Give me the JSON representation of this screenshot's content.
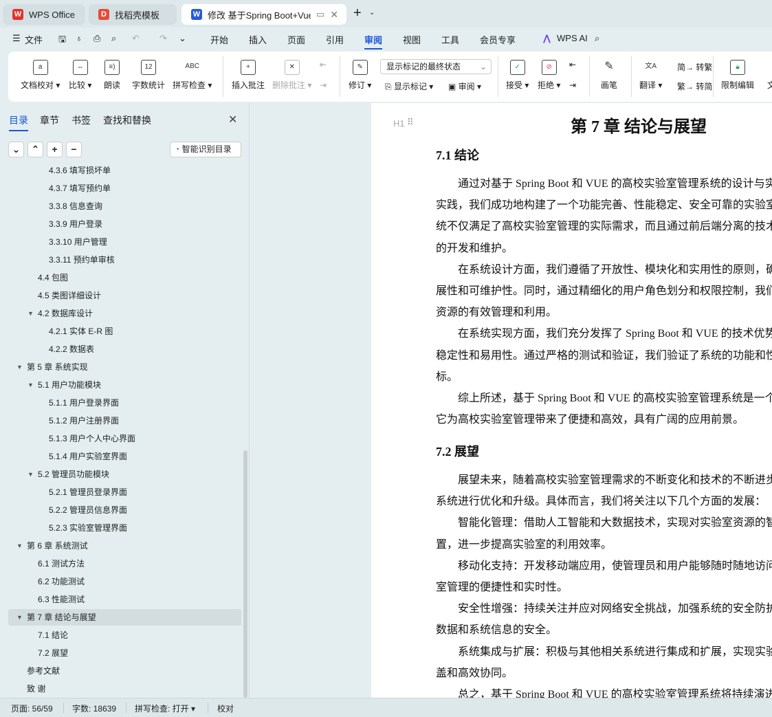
{
  "tabs": [
    {
      "label": "WPS Office",
      "icon": "wps-logo",
      "color": "#e3322b"
    },
    {
      "label": "找稻壳模板",
      "icon": "docer-logo",
      "color": "#e84b3c"
    },
    {
      "label": "修改 基于Spring Boot+Vue的",
      "icon": "word-doc-logo",
      "color": "#2a5ad9",
      "active": true
    }
  ],
  "menu": {
    "file": "文件",
    "items": [
      "开始",
      "插入",
      "页面",
      "引用",
      "审阅",
      "视图",
      "工具",
      "会员专享"
    ],
    "active": "审阅",
    "ai": "WPS AI"
  },
  "ribbon": {
    "proofread": "文档校对",
    "compare": "比较",
    "read_aloud": "朗读",
    "word_count": "字数统计",
    "spell_check": "拼写检查",
    "insert_comment": "插入批注",
    "delete_comment": "删除批注",
    "track_changes": "修订",
    "markup_select": "显示标记的最终状态",
    "show_markup": "显示标记",
    "review": "审阅",
    "accept": "接受",
    "reject": "拒绝",
    "pen": "画笔",
    "translate": "翻译",
    "to_traditional": "转繁",
    "to_simplified": "转简",
    "restrict_edit": "限制编辑",
    "doc_cut": "文"
  },
  "sidebar": {
    "tabs": [
      "目录",
      "章节",
      "书签",
      "查找和替换"
    ],
    "smart_toc": "智能识别目录",
    "items": [
      {
        "label": "4.3.6 填写损坏单",
        "level": 3
      },
      {
        "label": "4.3.7 填写预约单",
        "level": 3
      },
      {
        "label": "3.3.8 信息查询",
        "level": 3
      },
      {
        "label": "3.3.9 用户登录",
        "level": 3
      },
      {
        "label": "3.3.10 用户管理",
        "level": 3
      },
      {
        "label": "3.3.11 预约单审核",
        "level": 3
      },
      {
        "label": "4.4  包图",
        "level": 2
      },
      {
        "label": "4.5 类图详细设计",
        "level": 2
      },
      {
        "label": "4.2  数据库设计",
        "level": 2,
        "expanded": true
      },
      {
        "label": "4.2.1  实体 E-R 图",
        "level": 3
      },
      {
        "label": "4.2.2  数据表",
        "level": 3
      },
      {
        "label": "第 5 章  系统实现",
        "level": 1,
        "expanded": true
      },
      {
        "label": "5.1  用户功能模块",
        "level": 2,
        "expanded": true
      },
      {
        "label": "5.1.1  用户登录界面",
        "level": 3
      },
      {
        "label": "5.1.2  用户注册界面",
        "level": 3
      },
      {
        "label": "5.1.3  用户个人中心界面",
        "level": 3
      },
      {
        "label": "5.1.4  用户实验室界面",
        "level": 3
      },
      {
        "label": "5.2  管理员功能模块",
        "level": 2,
        "expanded": true
      },
      {
        "label": "5.2.1  管理员登录界面",
        "level": 3
      },
      {
        "label": "5.2.2  管理员信息界面",
        "level": 3
      },
      {
        "label": "5.2.3  实验室管理界面",
        "level": 3
      },
      {
        "label": "第 6 章  系统测试",
        "level": 1,
        "expanded": true
      },
      {
        "label": "6.1  测试方法",
        "level": 2
      },
      {
        "label": "6.2  功能测试",
        "level": 2
      },
      {
        "label": "6.3  性能测试",
        "level": 2
      },
      {
        "label": "第 7 章   结论与展望",
        "level": 1,
        "expanded": true,
        "selected": true
      },
      {
        "label": "7.1  结论",
        "level": 2
      },
      {
        "label": "7.2  展望",
        "level": 2
      },
      {
        "label": "参考文献",
        "level": 1
      },
      {
        "label": "致   谢",
        "level": 1
      }
    ]
  },
  "document": {
    "heading_marker": "H1",
    "chapter_title": "第 7 章   结论与展望",
    "sec1": "7.1  结论",
    "sec2": "7.2  展望",
    "lines1": [
      {
        "t": "通过对基于 Spring Boot 和 VUE 的高校实验室管理系统的设计与实",
        "i": true
      },
      {
        "t": "实践，我们成功地构建了一个功能完善、性能稳定、安全可靠的实验室"
      },
      {
        "t": "统不仅满足了高校实验室管理的实际需求，而且通过前后端分离的技术"
      },
      {
        "t": "的开发和维护。"
      },
      {
        "t": "在系统设计方面，我们遵循了开放性、模块化和实用性的原则，确",
        "i": true
      },
      {
        "t": "展性和可维护性。同时，通过精细化的用户角色划分和权限控制，我们"
      },
      {
        "t": "资源的有效管理和利用。"
      },
      {
        "t": "在系统实现方面，我们充分发挥了 Spring Boot 和 VUE 的技术优势",
        "i": true
      },
      {
        "t": "稳定性和易用性。通过严格的测试和验证，我们验证了系统的功能和性"
      },
      {
        "t": "标。"
      },
      {
        "t": "综上所述，基于 Spring Boot 和 VUE 的高校实验室管理系统是一个成",
        "i": true
      },
      {
        "t": "它为高校实验室管理带来了便捷和高效，具有广阔的应用前景。"
      }
    ],
    "lines2": [
      {
        "t": "展望未来，随着高校实验室管理需求的不断变化和技术的不断进步",
        "i": true
      },
      {
        "t": "系统进行优化和升级。具体而言，我们将关注以下几个方面的发展："
      },
      {
        "t": "智能化管理：借助人工智能和大数据技术，实现对实验室资源的智",
        "i": true
      },
      {
        "t": "置，进一步提高实验室的利用效率。"
      },
      {
        "t": "移动化支持：开发移动端应用，使管理员和用户能够随时随地访问",
        "i": true
      },
      {
        "t": "室管理的便捷性和实时性。"
      },
      {
        "t": "安全性增强：持续关注并应对网络安全挑战，加强系统的安全防护",
        "i": true
      },
      {
        "t": "数据和系统信息的安全。"
      },
      {
        "t": "系统集成与扩展：积极与其他相关系统进行集成和扩展，实现实验",
        "i": true
      },
      {
        "t": "盖和高效协同。"
      },
      {
        "t": "总之，基于 Spring Boot 和 VUE 的高校实验室管理系统将持续演进",
        "i": true
      }
    ]
  },
  "status": {
    "page": "页面: 56/59",
    "words": "字数: 18639",
    "spell": "拼写检查: 打开",
    "proof": "校对"
  },
  "colors": {
    "accent": "#1a55d8",
    "selected_row": "#d3dcde"
  }
}
